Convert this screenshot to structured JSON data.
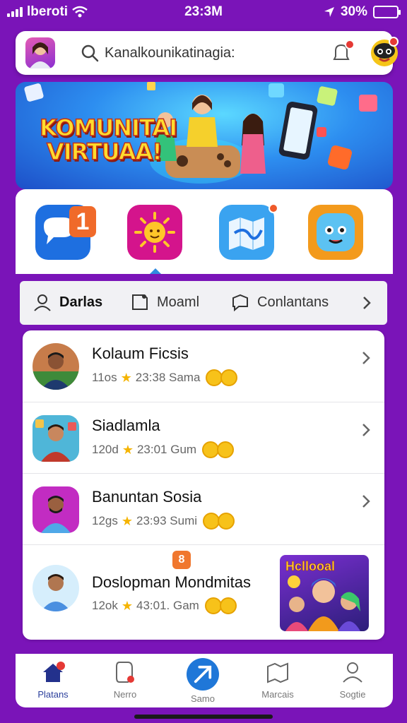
{
  "status_bar": {
    "carrier": "lberoti",
    "time": "23:3M",
    "battery": "30%"
  },
  "search": {
    "placeholder": "Kanalkounikatinagia:",
    "notification_count": "0"
  },
  "banner": {
    "title_line1": "KOMUNITAI",
    "title_line2": "VIRTUAA!"
  },
  "app_tiles": [
    {
      "icon": "chat-icon",
      "badge": "1",
      "color": "#1e6fe0"
    },
    {
      "icon": "sun-icon",
      "color": "#d4148c"
    },
    {
      "icon": "map-icon",
      "color": "#3aa3f0"
    },
    {
      "icon": "mascot-icon",
      "color": "#f39a1c"
    }
  ],
  "tabs": [
    {
      "label": "Darlas",
      "active": true
    },
    {
      "label": "Moaml",
      "active": false
    },
    {
      "label": "Conlantans",
      "active": false
    }
  ],
  "list": [
    {
      "title": "Kolaum Ficsis",
      "count": "11os",
      "time": "23:38 Sama"
    },
    {
      "title": "Siadlamla",
      "count": "120d",
      "time": "23:01 Gum"
    },
    {
      "title": "Banuntan Sosia",
      "count": "12gs",
      "time": "23:93 Sumi"
    },
    {
      "title": "Doslopman Mondmitas",
      "count": "12ok",
      "time": "43:01. Gam",
      "thumbnail_label": "Hcllooal",
      "badge": "8"
    }
  ],
  "bottom_nav": [
    {
      "label": "Platans",
      "icon": "home-icon",
      "active": true
    },
    {
      "label": "Nerro",
      "icon": "search-icon",
      "active": false
    },
    {
      "label": "Samo",
      "icon": "compose-icon",
      "active": false
    },
    {
      "label": "Marcais",
      "icon": "map-icon",
      "active": false
    },
    {
      "label": "Sogtie",
      "icon": "profile-icon",
      "active": false
    }
  ],
  "colors": {
    "background": "#7a14b8",
    "accent": "#1f77d8",
    "badge": "#e53935"
  }
}
